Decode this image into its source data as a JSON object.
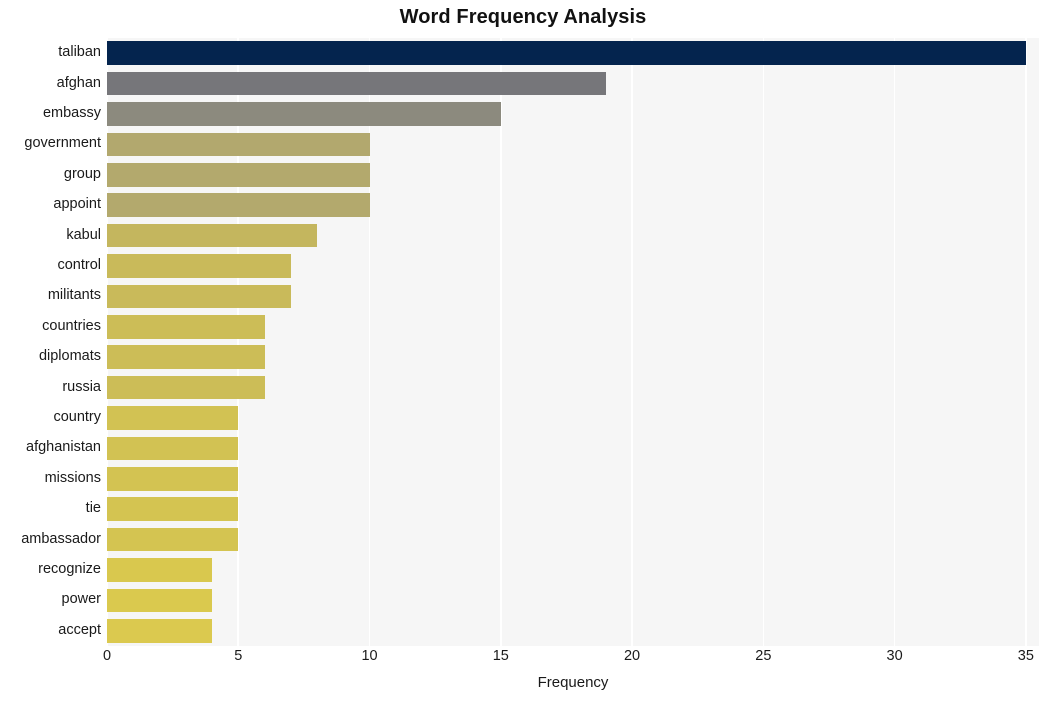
{
  "chart_data": {
    "type": "bar",
    "orientation": "horizontal",
    "title": "Word Frequency Analysis",
    "xlabel": "Frequency",
    "ylabel": "",
    "xlim": [
      0,
      35.5
    ],
    "xticks": [
      0,
      5,
      10,
      15,
      20,
      25,
      30,
      35
    ],
    "xtick_labels": [
      "0",
      "5",
      "10",
      "15",
      "20",
      "25",
      "30",
      "35"
    ],
    "grid": "vertical-white",
    "legend": null,
    "categories": [
      "taliban",
      "afghan",
      "embassy",
      "government",
      "group",
      "appoint",
      "kabul",
      "control",
      "militants",
      "countries",
      "diplomats",
      "russia",
      "country",
      "afghanistan",
      "missions",
      "tie",
      "ambassador",
      "recognize",
      "power",
      "accept"
    ],
    "values": [
      35,
      19,
      15,
      10,
      10,
      10,
      8,
      7,
      7,
      6,
      6,
      6,
      5,
      5,
      5,
      5,
      5,
      4,
      4,
      4
    ],
    "bar_colors": [
      "#04244e",
      "#76767a",
      "#8c8a7e",
      "#b2a86e",
      "#b3a96d",
      "#b3a96d",
      "#c4b65e",
      "#c9ba5a",
      "#c9ba5a",
      "#ccbd57",
      "#ccbd57",
      "#ccbd57",
      "#d2c253",
      "#d2c253",
      "#d3c352",
      "#d4c451",
      "#d4c451",
      "#d9c84e",
      "#dac94e",
      "#dbc94f"
    ],
    "plot_background": "#f6f6f6",
    "gridline_color": "#ffffff",
    "figure_background": "#ffffff"
  },
  "colors": {
    "accent_dark": "#04244e",
    "accent_light": "#dbc94f",
    "text": "#1a1a1a",
    "title": "#111111"
  }
}
